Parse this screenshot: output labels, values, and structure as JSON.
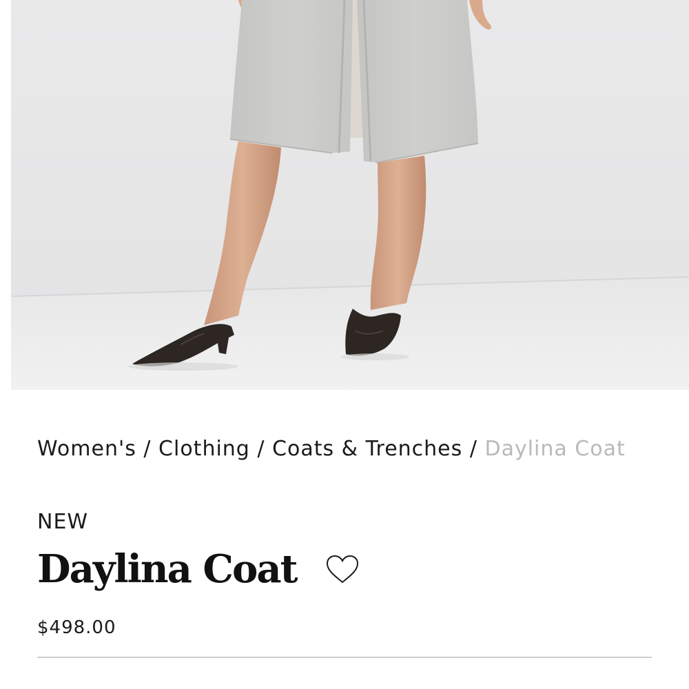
{
  "hero_image": {
    "icon": "product-photo",
    "alt": "Daylina Coat"
  },
  "breadcrumb": {
    "items": [
      "Women's",
      "Clothing",
      "Coats & Trenches"
    ],
    "separator": "/",
    "current": "Daylina Coat"
  },
  "product": {
    "badge": "NEW",
    "name": "Daylina Coat",
    "price": "$498.00",
    "wishlist_icon": "heart-outline-icon"
  },
  "colors": {
    "text": "#1a1a1a",
    "breadcrumb_current": "#b9b9b9",
    "divider": "#cfcfcf"
  }
}
